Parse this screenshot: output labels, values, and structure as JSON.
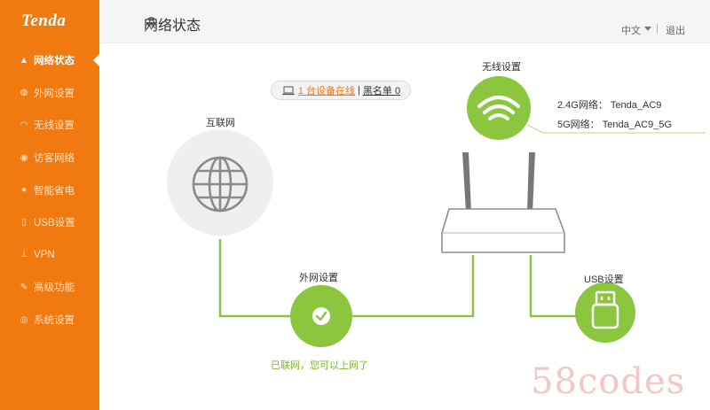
{
  "brand": {
    "logo": "Tenda"
  },
  "sidebar": {
    "items": [
      {
        "label": "网络状态",
        "icon": "router-icon",
        "glyph": "▲"
      },
      {
        "label": "外网设置",
        "icon": "globe-icon",
        "glyph": "◍"
      },
      {
        "label": "无线设置",
        "icon": "wifi-icon",
        "glyph": "◠"
      },
      {
        "label": "访客网络",
        "icon": "guest-icon",
        "glyph": "◉"
      },
      {
        "label": "智能省电",
        "icon": "leaf-icon",
        "glyph": "●"
      },
      {
        "label": "USB设置",
        "icon": "usb-icon",
        "glyph": "▯"
      },
      {
        "label": "VPN",
        "icon": "vpn-icon",
        "glyph": "⊥"
      },
      {
        "label": "高级功能",
        "icon": "wrench-icon",
        "glyph": "✎"
      },
      {
        "label": "系统设置",
        "icon": "system-icon",
        "glyph": "◎"
      }
    ]
  },
  "header": {
    "title": "网络状态",
    "language": "中文",
    "separator": "|",
    "logout": "退出"
  },
  "status_bar": {
    "devices_online": "1 台设备在线",
    "separator": "|",
    "blacklist": "黑名单 0"
  },
  "topology": {
    "internet_label": "互联网",
    "wan_label": "外网设置",
    "wan_status": "已联网，您可以上网了",
    "wireless_label": "无线设置",
    "wifi_24": "2.4G网络： Tenda_AC9",
    "wifi_5": "5G网络： Tenda_AC9_5G",
    "usb_label": "USB设置"
  },
  "watermark": "58codes",
  "colors": {
    "sidebar": "#f07a10",
    "green": "#8cc63f",
    "line": "#8fc14a",
    "internet": "#efefef"
  }
}
